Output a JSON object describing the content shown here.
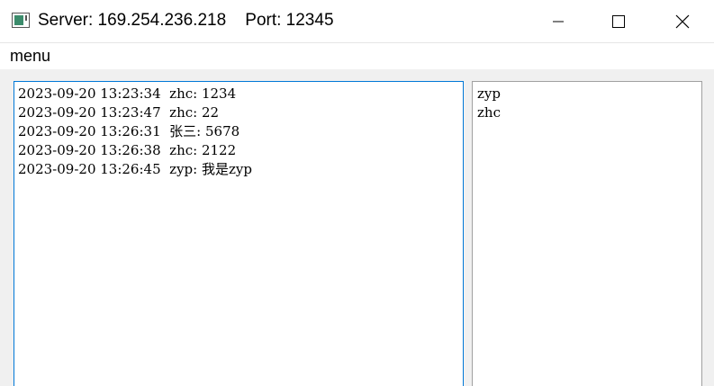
{
  "window": {
    "title": "Server: 169.254.236.218    Port: 12345",
    "icon": "app-window-icon",
    "controls": {
      "minimize_icon": "minimize-icon",
      "maximize_icon": "maximize-icon",
      "close_icon": "close-icon"
    }
  },
  "menubar": {
    "items": [
      {
        "label": "menu"
      }
    ]
  },
  "chat": {
    "messages": [
      {
        "time": "2023-09-20 13:23:34",
        "text": "zhc: 1234"
      },
      {
        "time": "2023-09-20 13:23:47",
        "text": "zhc: 22"
      },
      {
        "time": "2023-09-20 13:26:31",
        "text": "张三: 5678"
      },
      {
        "time": "2023-09-20 13:26:38",
        "text": "zhc: 2122"
      },
      {
        "time": "2023-09-20 13:26:45",
        "text": "zyp: 我是zyp"
      }
    ]
  },
  "users": {
    "items": [
      {
        "name": "zyp"
      },
      {
        "name": "zhc"
      }
    ]
  },
  "colors": {
    "focus_border": "#0078d7",
    "border": "#a0a0a0",
    "background": "#f0f0f0"
  }
}
